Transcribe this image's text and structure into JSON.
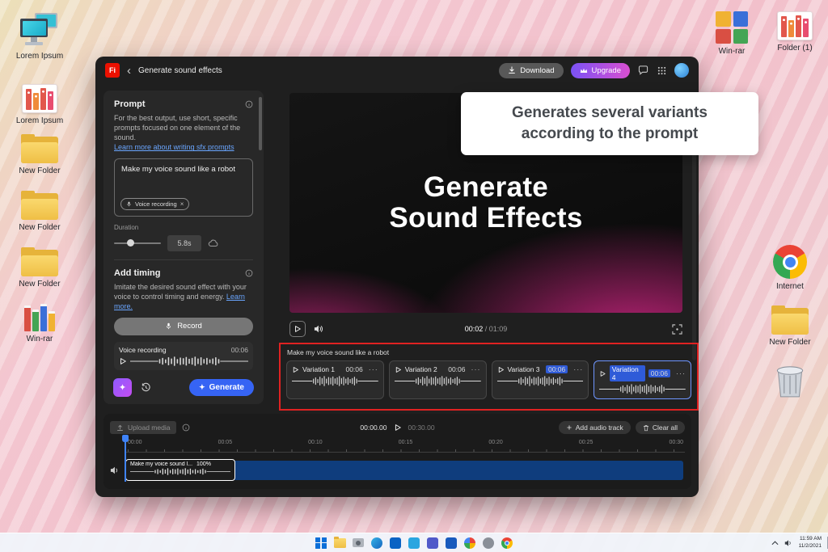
{
  "colors": {
    "adobe_red": "#eb1000",
    "accent_blue": "#3664f4",
    "upgrade_gradient_start": "#7b52f5",
    "upgrade_gradient_end": "#d94fd0",
    "annotation_red": "#e02222",
    "selection_blue": "#2f5bd8",
    "track_blue": "#0f3d7d",
    "playhead_blue": "#3f83f8"
  },
  "desktop": {
    "icons_left": [
      {
        "label": "Lorem Ipsum"
      },
      {
        "label": "Lorem Ipsum"
      },
      {
        "label": "New Folder"
      },
      {
        "label": "New Folder"
      },
      {
        "label": "New Folder"
      },
      {
        "label": "Win-rar"
      }
    ],
    "icons_top_right": [
      {
        "label": "Win-rar"
      },
      {
        "label": "Folder (1)"
      }
    ],
    "icons_right": [
      {
        "label": "Internet"
      },
      {
        "label": "New Folder"
      },
      {
        "label": ""
      }
    ]
  },
  "window": {
    "logo": "Fi",
    "title": "Generate sound effects",
    "download_label": "Download",
    "upgrade_label": "Upgrade"
  },
  "prompt_panel": {
    "title": "Prompt",
    "description": "For the best output, use short, specific prompts focused on one element of the sound.",
    "link": "Learn more about writing sfx prompts",
    "prompt_value": "Make my voice sound like a robot",
    "chip_label": "Voice recording",
    "duration_label": "Duration",
    "duration_value": "5.8s",
    "add_timing_title": "Add timing",
    "add_timing_desc": "Imitate the desired sound effect with your voice to control timing and energy.",
    "add_timing_link": "Learn more.",
    "record_label": "Record",
    "recording_name": "Voice recording",
    "recording_time": "00:06",
    "generate_label": "Generate"
  },
  "preview": {
    "title_line1": "Generate",
    "title_line2": "Sound Effects",
    "current_time": "00:02",
    "separator": "/",
    "total_time": "01:09"
  },
  "variations": {
    "prompt": "Make my voice sound like a robot",
    "items": [
      {
        "label": "Variation 1",
        "time": "00:06"
      },
      {
        "label": "Variation 2",
        "time": "00:06"
      },
      {
        "label": "Variation 3",
        "time": "00:06"
      },
      {
        "label": "Variation 4",
        "time": "00:06"
      }
    ]
  },
  "timeline": {
    "upload_label": "Upload media",
    "current_time": "00:00.00",
    "total_time": "00:30.00",
    "add_audio_label": "Add audio track",
    "clear_label": "Clear all",
    "ticks": [
      "00:00",
      "00:05",
      "00:10",
      "00:15",
      "00:20",
      "00:25",
      "00:30"
    ],
    "clip_label": "Make my voice sound l...",
    "clip_volume": "100%"
  },
  "callout": {
    "text": "Generates several variants according to the prompt"
  },
  "taskbar": {
    "time": "11:59 AM",
    "date": "11/2/2021"
  },
  "icons": {
    "back": "‹",
    "chip_close": "×",
    "more": "···",
    "sparkle": "✦"
  }
}
